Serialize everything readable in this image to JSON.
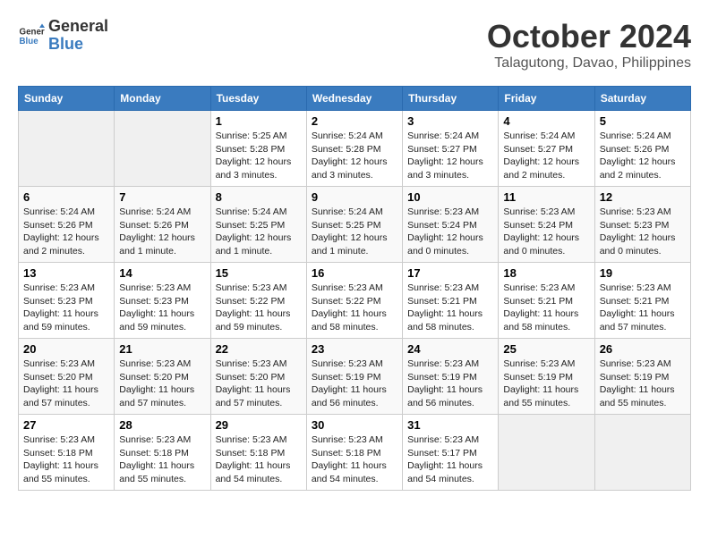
{
  "logo": {
    "line1": "General",
    "line2": "Blue"
  },
  "title": "October 2024",
  "location": "Talagutong, Davao, Philippines",
  "days_header": [
    "Sunday",
    "Monday",
    "Tuesday",
    "Wednesday",
    "Thursday",
    "Friday",
    "Saturday"
  ],
  "weeks": [
    [
      {
        "day": "",
        "empty": true
      },
      {
        "day": "",
        "empty": true
      },
      {
        "day": "1",
        "sunrise": "5:25 AM",
        "sunset": "5:28 PM",
        "daylight": "12 hours and 3 minutes."
      },
      {
        "day": "2",
        "sunrise": "5:24 AM",
        "sunset": "5:28 PM",
        "daylight": "12 hours and 3 minutes."
      },
      {
        "day": "3",
        "sunrise": "5:24 AM",
        "sunset": "5:27 PM",
        "daylight": "12 hours and 3 minutes."
      },
      {
        "day": "4",
        "sunrise": "5:24 AM",
        "sunset": "5:27 PM",
        "daylight": "12 hours and 2 minutes."
      },
      {
        "day": "5",
        "sunrise": "5:24 AM",
        "sunset": "5:26 PM",
        "daylight": "12 hours and 2 minutes."
      }
    ],
    [
      {
        "day": "6",
        "sunrise": "5:24 AM",
        "sunset": "5:26 PM",
        "daylight": "12 hours and 2 minutes."
      },
      {
        "day": "7",
        "sunrise": "5:24 AM",
        "sunset": "5:26 PM",
        "daylight": "12 hours and 1 minute."
      },
      {
        "day": "8",
        "sunrise": "5:24 AM",
        "sunset": "5:25 PM",
        "daylight": "12 hours and 1 minute."
      },
      {
        "day": "9",
        "sunrise": "5:24 AM",
        "sunset": "5:25 PM",
        "daylight": "12 hours and 1 minute."
      },
      {
        "day": "10",
        "sunrise": "5:23 AM",
        "sunset": "5:24 PM",
        "daylight": "12 hours and 0 minutes."
      },
      {
        "day": "11",
        "sunrise": "5:23 AM",
        "sunset": "5:24 PM",
        "daylight": "12 hours and 0 minutes."
      },
      {
        "day": "12",
        "sunrise": "5:23 AM",
        "sunset": "5:23 PM",
        "daylight": "12 hours and 0 minutes."
      }
    ],
    [
      {
        "day": "13",
        "sunrise": "5:23 AM",
        "sunset": "5:23 PM",
        "daylight": "11 hours and 59 minutes."
      },
      {
        "day": "14",
        "sunrise": "5:23 AM",
        "sunset": "5:23 PM",
        "daylight": "11 hours and 59 minutes."
      },
      {
        "day": "15",
        "sunrise": "5:23 AM",
        "sunset": "5:22 PM",
        "daylight": "11 hours and 59 minutes."
      },
      {
        "day": "16",
        "sunrise": "5:23 AM",
        "sunset": "5:22 PM",
        "daylight": "11 hours and 58 minutes."
      },
      {
        "day": "17",
        "sunrise": "5:23 AM",
        "sunset": "5:21 PM",
        "daylight": "11 hours and 58 minutes."
      },
      {
        "day": "18",
        "sunrise": "5:23 AM",
        "sunset": "5:21 PM",
        "daylight": "11 hours and 58 minutes."
      },
      {
        "day": "19",
        "sunrise": "5:23 AM",
        "sunset": "5:21 PM",
        "daylight": "11 hours and 57 minutes."
      }
    ],
    [
      {
        "day": "20",
        "sunrise": "5:23 AM",
        "sunset": "5:20 PM",
        "daylight": "11 hours and 57 minutes."
      },
      {
        "day": "21",
        "sunrise": "5:23 AM",
        "sunset": "5:20 PM",
        "daylight": "11 hours and 57 minutes."
      },
      {
        "day": "22",
        "sunrise": "5:23 AM",
        "sunset": "5:20 PM",
        "daylight": "11 hours and 57 minutes."
      },
      {
        "day": "23",
        "sunrise": "5:23 AM",
        "sunset": "5:19 PM",
        "daylight": "11 hours and 56 minutes."
      },
      {
        "day": "24",
        "sunrise": "5:23 AM",
        "sunset": "5:19 PM",
        "daylight": "11 hours and 56 minutes."
      },
      {
        "day": "25",
        "sunrise": "5:23 AM",
        "sunset": "5:19 PM",
        "daylight": "11 hours and 55 minutes."
      },
      {
        "day": "26",
        "sunrise": "5:23 AM",
        "sunset": "5:19 PM",
        "daylight": "11 hours and 55 minutes."
      }
    ],
    [
      {
        "day": "27",
        "sunrise": "5:23 AM",
        "sunset": "5:18 PM",
        "daylight": "11 hours and 55 minutes."
      },
      {
        "day": "28",
        "sunrise": "5:23 AM",
        "sunset": "5:18 PM",
        "daylight": "11 hours and 55 minutes."
      },
      {
        "day": "29",
        "sunrise": "5:23 AM",
        "sunset": "5:18 PM",
        "daylight": "11 hours and 54 minutes."
      },
      {
        "day": "30",
        "sunrise": "5:23 AM",
        "sunset": "5:18 PM",
        "daylight": "11 hours and 54 minutes."
      },
      {
        "day": "31",
        "sunrise": "5:23 AM",
        "sunset": "5:17 PM",
        "daylight": "11 hours and 54 minutes."
      },
      {
        "day": "",
        "empty": true
      },
      {
        "day": "",
        "empty": true
      }
    ]
  ]
}
